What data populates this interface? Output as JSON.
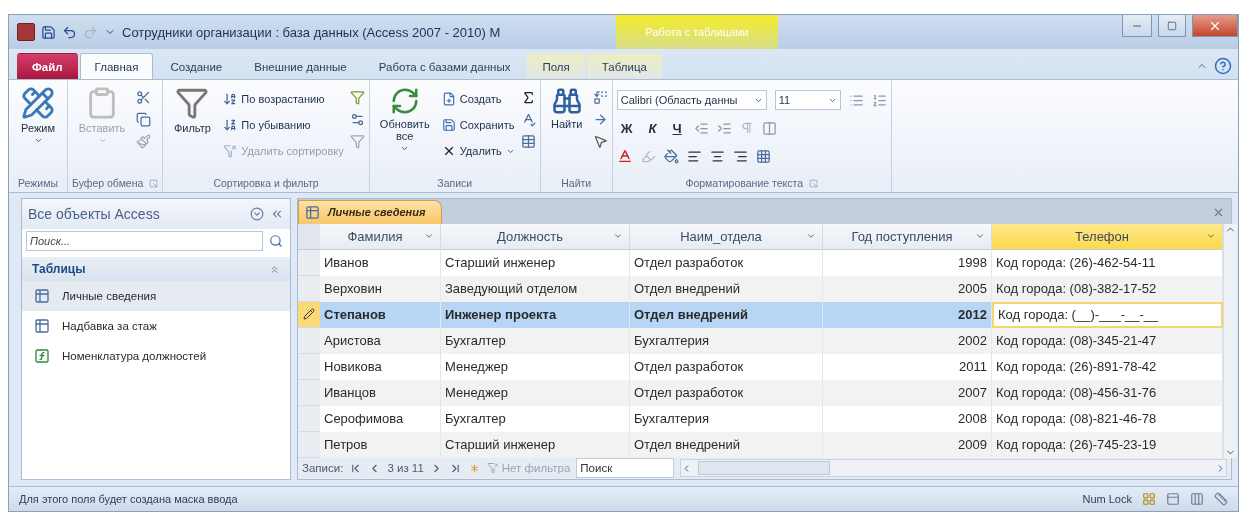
{
  "window": {
    "title": "Сотрудники организации : база данных (Access 2007 - 2010) M",
    "context_tab": "Работа с таблицами"
  },
  "tabs": [
    {
      "label": "Файл",
      "kind": "file",
      "selected": false
    },
    {
      "label": "Главная",
      "kind": "tab",
      "selected": true
    },
    {
      "label": "Создание",
      "kind": "tab",
      "selected": false
    },
    {
      "label": "Внешние данные",
      "kind": "tab",
      "selected": false
    },
    {
      "label": "Работа с базами данных",
      "kind": "tab",
      "selected": false
    },
    {
      "label": "Поля",
      "kind": "context",
      "selected": false
    },
    {
      "label": "Таблица",
      "kind": "context",
      "selected": false
    }
  ],
  "ribbon": {
    "groups": [
      {
        "label": "Режимы",
        "buttons": [
          {
            "label": "Режим",
            "disabled": false
          }
        ]
      },
      {
        "label": "Буфер обмена",
        "buttons": [
          {
            "label": "Вставить",
            "disabled": true
          }
        ]
      },
      {
        "label": "Сортировка и фильтр",
        "buttons": [
          {
            "label": "Фильтр",
            "disabled": false
          },
          {
            "label": "По возрастанию",
            "disabled": false
          },
          {
            "label": "По убыванию",
            "disabled": false
          },
          {
            "label": "Удалить сортировку",
            "disabled": true
          }
        ]
      },
      {
        "label": "Записи",
        "buttons": [
          {
            "label": "Обновить все",
            "disabled": false
          },
          {
            "label": "Создать",
            "disabled": false
          },
          {
            "label": "Сохранить",
            "disabled": false
          },
          {
            "label": "Удалить",
            "disabled": false
          }
        ]
      },
      {
        "label": "Найти",
        "buttons": [
          {
            "label": "Найти",
            "disabled": false
          }
        ]
      },
      {
        "label": "Форматирование текста",
        "font": "Calibri (Область данны",
        "size": "11",
        "bold": "Ж",
        "italic": "К",
        "underline": "Ч"
      }
    ]
  },
  "nav": {
    "title": "Все объекты Access",
    "placeholder": "Поиск...",
    "groups": [
      {
        "label": "Таблицы",
        "items": [
          {
            "label": "Личные сведения",
            "kind": "table",
            "selected": true
          },
          {
            "label": "Надбавка за стаж",
            "kind": "table",
            "selected": false
          },
          {
            "label": "Номенклатура должностей",
            "kind": "query",
            "selected": false
          }
        ]
      }
    ]
  },
  "document_tab": {
    "label": "Личные сведения"
  },
  "table": {
    "columns": [
      {
        "label": "Фамилия",
        "kind": "text",
        "selected": false
      },
      {
        "label": "Должность",
        "kind": "text",
        "selected": false
      },
      {
        "label": "Наим_отдела",
        "kind": "text",
        "selected": false
      },
      {
        "label": "Год поступления",
        "kind": "number",
        "selected": false
      },
      {
        "label": "Телефон",
        "kind": "text",
        "selected": true
      }
    ],
    "rows": [
      {
        "cells": [
          "Иванов",
          "Старший инженер",
          "Отдел разработок",
          "1998",
          "Код города: (26)-462-54-11"
        ],
        "selected": false,
        "editing": false
      },
      {
        "cells": [
          "Верховин",
          "Заведующий отделом",
          "Отдел внедрений",
          "2005",
          "Код города: (08)-382-17-52"
        ],
        "selected": false,
        "editing": false
      },
      {
        "cells": [
          "Степанов",
          "Инженер проекта",
          "Отдел внедрений",
          "2012",
          "Код города: (__)-___-__-__"
        ],
        "selected": true,
        "editing": true
      },
      {
        "cells": [
          "Аристова",
          "Бухгалтер",
          "Бухгалтерия",
          "2002",
          "Код города: (08)-345-21-47"
        ],
        "selected": false,
        "editing": false
      },
      {
        "cells": [
          "Новикова",
          "Менеджер",
          "Отдел разработок",
          "2011",
          "Код города: (26)-891-78-42"
        ],
        "selected": false,
        "editing": false
      },
      {
        "cells": [
          "Иванцов",
          "Менеджер",
          "Отдел разработок",
          "2007",
          "Код города: (08)-456-31-76"
        ],
        "selected": false,
        "editing": false
      },
      {
        "cells": [
          "Серофимова",
          "Бухгалтер",
          "Бухгалтерия",
          "2008",
          "Код города: (08)-821-46-78"
        ],
        "selected": false,
        "editing": false
      },
      {
        "cells": [
          "Петров",
          "Старший инженер",
          "Отдел внедрений",
          "2009",
          "Код города: (26)-745-23-19"
        ],
        "selected": false,
        "editing": false
      }
    ]
  },
  "record_nav": {
    "label": "Записи:",
    "position": "3 из 11",
    "filter": "Нет фильтра",
    "search": "Поиск"
  },
  "status_bar": {
    "message": "Для этого поля будет создана маска ввода",
    "num_lock": "Num Lock"
  }
}
